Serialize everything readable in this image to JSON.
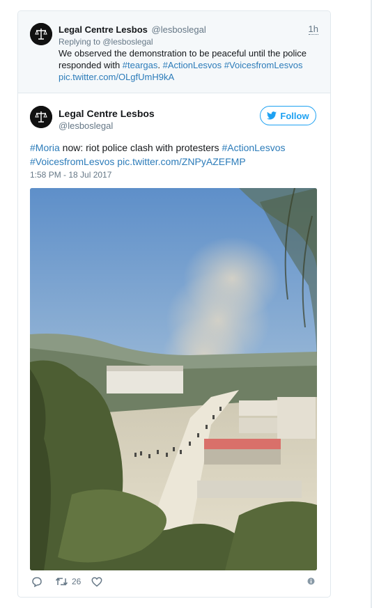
{
  "reply_tweet": {
    "author_name": "Legal Centre Lesbos",
    "author_handle": "@lesboslegal",
    "time": "1h",
    "replying_to": "Replying to @lesboslegal",
    "text_plain_1": "We observed the demonstration to be peaceful until the police responded with ",
    "hashtag_1": "#teargas",
    "text_plain_2": ". ",
    "hashtag_2": "#ActionLesvos",
    "text_plain_3": " ",
    "hashtag_3": "#VoicesfromLesvos",
    "link": "pic.twitter.com/OLgfUmH9kA"
  },
  "main_tweet": {
    "author_name": "Legal Centre Lesbos",
    "author_handle": "@lesboslegal",
    "follow_label": "Follow",
    "hashtag_moria": "#Moria",
    "text_1": " now: riot police clash with protesters ",
    "hashtag_action": "#ActionLesvos",
    "hashtag_voices": "#VoicesfromLesvos",
    "link": "pic.twitter.com/ZNPyAZEFMP",
    "date": "1:58 PM - 18 Jul 2017"
  },
  "actions": {
    "retweet_count": "26"
  },
  "icons": {
    "reply": "reply-icon",
    "retweet": "retweet-icon",
    "like": "heart-icon",
    "info": "info-icon",
    "bird": "twitter-bird-icon"
  },
  "colors": {
    "link": "#2b7bb9",
    "follow_blue": "#1da1f2",
    "muted": "#657786",
    "reply_bg": "#f5f8fa"
  }
}
